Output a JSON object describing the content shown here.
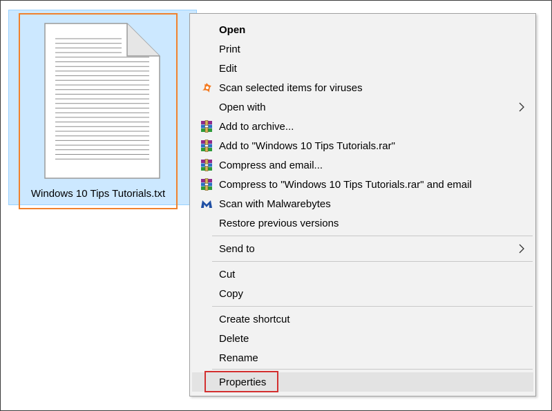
{
  "file": {
    "name": "Windows 10 Tips Tutorials.txt",
    "icon": "text-document-icon"
  },
  "menu": {
    "items": [
      {
        "id": "open",
        "label": "Open",
        "bold": true
      },
      {
        "id": "print",
        "label": "Print"
      },
      {
        "id": "edit",
        "label": "Edit"
      },
      {
        "id": "scan-viruses",
        "label": "Scan selected items for viruses",
        "icon": "avast-icon"
      },
      {
        "id": "open-with",
        "label": "Open with",
        "submenu": true
      },
      {
        "id": "add-archive",
        "label": "Add to archive...",
        "icon": "winrar-icon"
      },
      {
        "id": "add-rar",
        "label": "Add to \"Windows 10 Tips Tutorials.rar\"",
        "icon": "winrar-icon"
      },
      {
        "id": "compress-email",
        "label": "Compress and email...",
        "icon": "winrar-icon"
      },
      {
        "id": "compress-rar-email",
        "label": "Compress to \"Windows 10 Tips Tutorials.rar\" and email",
        "icon": "winrar-icon"
      },
      {
        "id": "malwarebytes",
        "label": "Scan with Malwarebytes",
        "icon": "malwarebytes-icon"
      },
      {
        "id": "restore-versions",
        "label": "Restore previous versions"
      },
      {
        "id": "send-to",
        "label": "Send to",
        "submenu": true
      },
      {
        "id": "cut",
        "label": "Cut"
      },
      {
        "id": "copy",
        "label": "Copy"
      },
      {
        "id": "create-shortcut",
        "label": "Create shortcut"
      },
      {
        "id": "delete",
        "label": "Delete"
      },
      {
        "id": "rename",
        "label": "Rename"
      },
      {
        "id": "properties",
        "label": "Properties",
        "hovered": true
      }
    ]
  },
  "colors": {
    "selection_fill": "#cce8ff",
    "focus_outline": "#f0812c",
    "highlight_outline": "#d32f2f",
    "menu_bg": "#f2f2f2"
  }
}
